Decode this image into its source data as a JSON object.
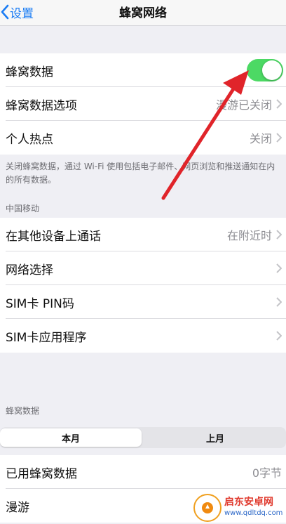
{
  "nav": {
    "back_label": "设置",
    "title": "蜂窝网络"
  },
  "cellular": {
    "rows": [
      {
        "label": "蜂窝数据",
        "toggle_on": true
      },
      {
        "label": "蜂窝数据选项",
        "value": "漫游已关闭"
      },
      {
        "label": "个人热点",
        "value": "关闭"
      }
    ],
    "footnote": "关闭蜂窝数据，通过 Wi-Fi 使用包括电子邮件、网页浏览和推送通知在内的所有数据。"
  },
  "carrier": {
    "header": "中国移动",
    "rows": [
      {
        "label": "在其他设备上通话",
        "value": "在附近时"
      },
      {
        "label": "网络选择",
        "value": ""
      },
      {
        "label": "SIM卡 PIN码",
        "value": ""
      },
      {
        "label": "SIM卡应用程序",
        "value": ""
      }
    ]
  },
  "usage": {
    "header": "蜂窝数据",
    "segments": [
      "本月",
      "上月"
    ],
    "selected_segment": "本月",
    "rows": [
      {
        "label": "已用蜂窝数据",
        "value": "0字节"
      },
      {
        "label": "漫游",
        "value": ""
      }
    ]
  },
  "annotation": {
    "arrow_color": "#e0242a"
  },
  "watermark": {
    "title": "启东安卓网",
    "url": "www.qdltdq.com"
  },
  "colors": {
    "accent": "#1a7cf4",
    "toggle_on": "#4cd964"
  }
}
